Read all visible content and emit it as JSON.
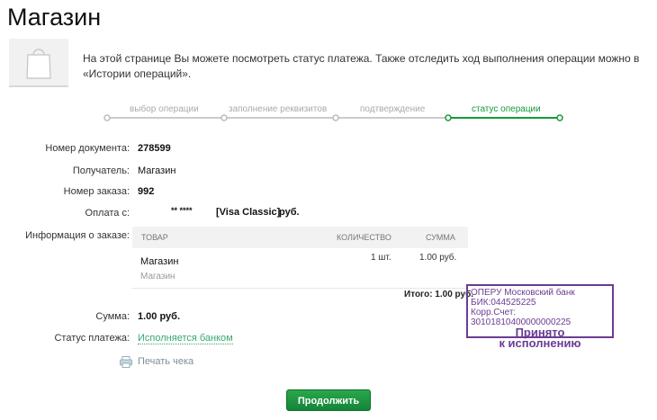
{
  "title": "Магазин",
  "intro": "На этой странице Вы можете посмотреть статус платежа. Также отследить ход выполнения операции можно в «Истории операций».",
  "steps": [
    {
      "label": "выбор операции",
      "active": false
    },
    {
      "label": "заполнение реквизитов",
      "active": false
    },
    {
      "label": "подтверждение",
      "active": false
    },
    {
      "label": "статус операции",
      "active": true
    }
  ],
  "details": {
    "doc_label": "Номер документа:",
    "doc_value": "278599",
    "recipient_label": "Получатель:",
    "recipient_value": "Магазин",
    "order_label": "Номер заказа:",
    "order_value": "992",
    "paid_from_label": "Оплата с:",
    "card_mask": "** ****",
    "card_type": "[Visa Classic]",
    "card_currency": "руб.",
    "order_info_label": "Информация о заказе:",
    "sum_label": "Сумма:",
    "sum_value": "1.00  руб.",
    "status_label": "Статус платежа:",
    "status_value": "Исполняется банком",
    "print_label": "Печать чека"
  },
  "order_table": {
    "headers": [
      "ТОВАР",
      "КОЛИЧЕСТВО",
      "СУММА"
    ],
    "item_name": "Магазин",
    "item_sub": "Магазин",
    "qty": "1 шт.",
    "sum": "1.00  руб.",
    "total": "Итого: 1.00 руб."
  },
  "stamp": {
    "line1": "ОПЕРУ Московский банк",
    "line2": "БИК:044525225",
    "line3": "Корр.Счет: 30101810400000000225",
    "line4": "Принято",
    "line5": "к исполнению",
    "color": "#6b3c93"
  },
  "continue_label": "Продолжить",
  "colors": {
    "accent": "#159a3a",
    "link": "#37a672"
  }
}
